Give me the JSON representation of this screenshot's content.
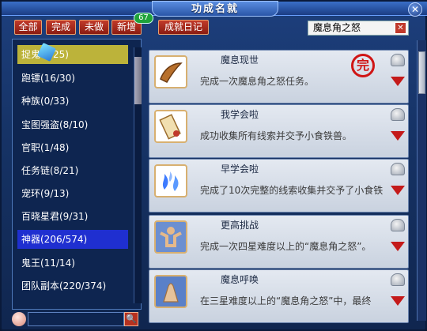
{
  "window": {
    "title": "功成名就",
    "close_label": "✕"
  },
  "filters": {
    "all": "全部",
    "done": "完成",
    "undone": "未做",
    "new": "新增",
    "new_count": "67",
    "diary": "成就日记"
  },
  "search": {
    "value": "魔息角之怒",
    "clear_label": "✕"
  },
  "categories": [
    {
      "label": "捉鬼(25/25)",
      "display": "捉鬼",
      "count": "25)"
    },
    {
      "label": "跑镖(16/30)"
    },
    {
      "label": "种族(0/33)"
    },
    {
      "label": "宝图强盗(8/10)"
    },
    {
      "label": "官职(1/48)"
    },
    {
      "label": "任务链(8/21)"
    },
    {
      "label": "宠环(9/13)"
    },
    {
      "label": "百晓星君(9/31)"
    },
    {
      "label": "神器(206/574)"
    },
    {
      "label": "鬼王(11/14)"
    },
    {
      "label": "团队副本(220/374)"
    }
  ],
  "bottom": {
    "search_button": "🔍"
  },
  "achievements": [
    {
      "title": "魔息现世",
      "desc": "完成一次魔息角之怒任务。",
      "seal": "完"
    },
    {
      "title": "我学会啦",
      "desc": "成功收集所有线索并交予小食铁兽。"
    },
    {
      "title": "早学会啦",
      "desc": "完成了10次完整的线索收集并交予了小食铁"
    },
    {
      "title": "更高挑战",
      "desc": "完成一次四星难度以上的“魔息角之怒”。"
    },
    {
      "title": "魔息呼唤",
      "desc": "在三星难度以上的“魔息角之怒”中，最终"
    }
  ],
  "colors": {
    "accent_red": "#c41a1a",
    "highlight_yellow": "#bcb33a",
    "selected_blue": "#1f2fd0",
    "badge_green": "#1fa23a"
  }
}
